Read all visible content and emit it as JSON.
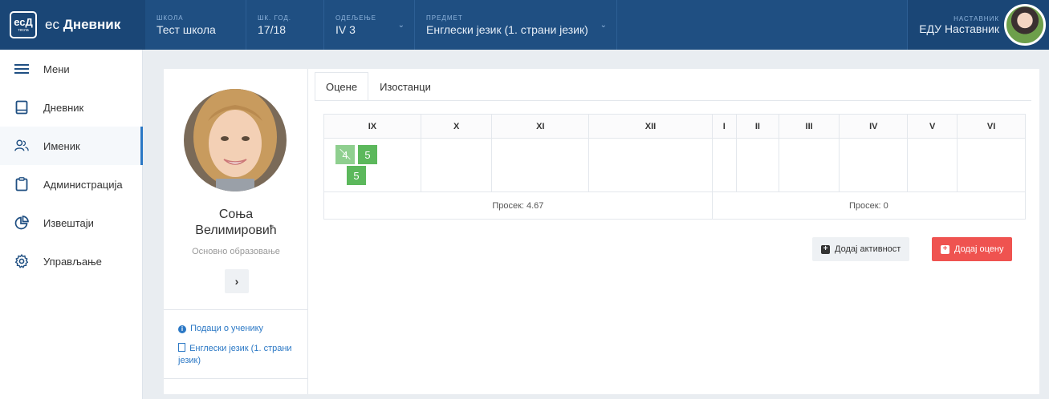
{
  "brand": {
    "logo_text": "есД",
    "logo_sub": "тесла",
    "name_prefix": "ес",
    "name": "Дневник"
  },
  "topbar": {
    "school": {
      "label": "ШКОЛА",
      "value": "Тест школа"
    },
    "school_year": {
      "label": "ШК. ГОД.",
      "value": "17/18"
    },
    "department": {
      "label": "ОДЕЉЕЊЕ",
      "value": "IV 3"
    },
    "subject": {
      "label": "ПРЕДМЕТ",
      "value": "Енглески језик (1. страни језик)"
    },
    "teacher": {
      "label": "НАСТАВНИК",
      "value": "ЕДУ Наставник"
    }
  },
  "sidebar": {
    "items": [
      {
        "label": "Мени",
        "icon": "menu-icon"
      },
      {
        "label": "Дневник",
        "icon": "book-icon"
      },
      {
        "label": "Именик",
        "icon": "users-icon",
        "active": true
      },
      {
        "label": "Администрација",
        "icon": "clipboard-icon"
      },
      {
        "label": "Извештаји",
        "icon": "pie-chart-icon"
      },
      {
        "label": "Управљање",
        "icon": "gear-icon"
      }
    ]
  },
  "student": {
    "first_name": "Соња",
    "last_name": "Велимировић",
    "education": "Основно образовање",
    "next_symbol": "›",
    "links": {
      "info": "Подаци о ученику",
      "subject": "Енглески језик (1. страни језик)"
    }
  },
  "tabs": [
    {
      "label": "Оцене",
      "active": true
    },
    {
      "label": "Изостанци"
    }
  ],
  "grades": {
    "months": [
      "IX",
      "X",
      "XI",
      "XII",
      "I",
      "II",
      "III",
      "IV",
      "V",
      "VI"
    ],
    "september": [
      "4",
      "5",
      "5"
    ],
    "averages": {
      "first": "Просек: 4.67",
      "second": "Просек: 0"
    }
  },
  "buttons": {
    "add_activity": "Додај активност",
    "add_grade": "Додај оцену"
  },
  "colors": {
    "topbar": "#1f4f82",
    "accent": "#2b78c5",
    "grade": "#5cb85c",
    "danger": "#ef5350"
  }
}
